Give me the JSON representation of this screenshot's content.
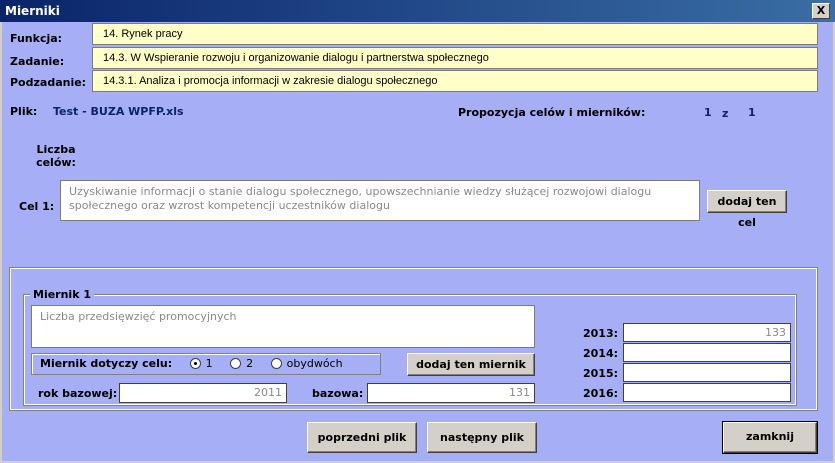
{
  "window": {
    "title": "Mierniki",
    "close_label": "X"
  },
  "labels": {
    "funkcja": "Funkcja:",
    "zadanie": "Zadanie:",
    "podzadanie": "Podzadanie:",
    "plik": "Plik:",
    "propozycja": "Propozycja celów i mierników:",
    "of": "z",
    "liczba_celow": "Liczba celów:",
    "cel": "Cel 1:"
  },
  "fields": {
    "funkcja": "14. Rynek pracy",
    "zadanie": "14.3. W Wspieranie rozwoju i organizowanie dialogu i partnerstwa społecznego",
    "podzadanie": "14.3.1. Analiza i promocja informacji w zakresie dialogu społecznego",
    "plik": "Test - BUZA WPFP.xls",
    "page_current": "1",
    "page_total": "1",
    "cel_text": "Uzyskiwanie informacji o stanie dialogu społecznego, upowszechnianie wiedzy służącej rozwojowi dialogu społecznego oraz wzrost kompetencji uczestników dialogu"
  },
  "buttons": {
    "dodaj_cel": "dodaj ten cel",
    "dodaj_miernik": "dodaj ten miernik",
    "poprzedni": "poprzedni plik",
    "nastepny": "następny plik",
    "zamknij": "zamknij"
  },
  "miernik": {
    "legend": "Miernik 1",
    "text": "Liczba przedsięwzięć promocyjnych",
    "dotyczy_label": "Miernik dotyczy celu:",
    "options": [
      "1",
      "2",
      "obydwóch"
    ],
    "selected": "1",
    "rok_bazowej_label": "rok bazowej:",
    "rok_bazowej": "2011",
    "bazowa_label": "bazowa:",
    "bazowa": "131",
    "years": [
      {
        "label": "2013:",
        "value": "133"
      },
      {
        "label": "2014:",
        "value": ""
      },
      {
        "label": "2015:",
        "value": ""
      },
      {
        "label": "2016:",
        "value": ""
      }
    ]
  }
}
